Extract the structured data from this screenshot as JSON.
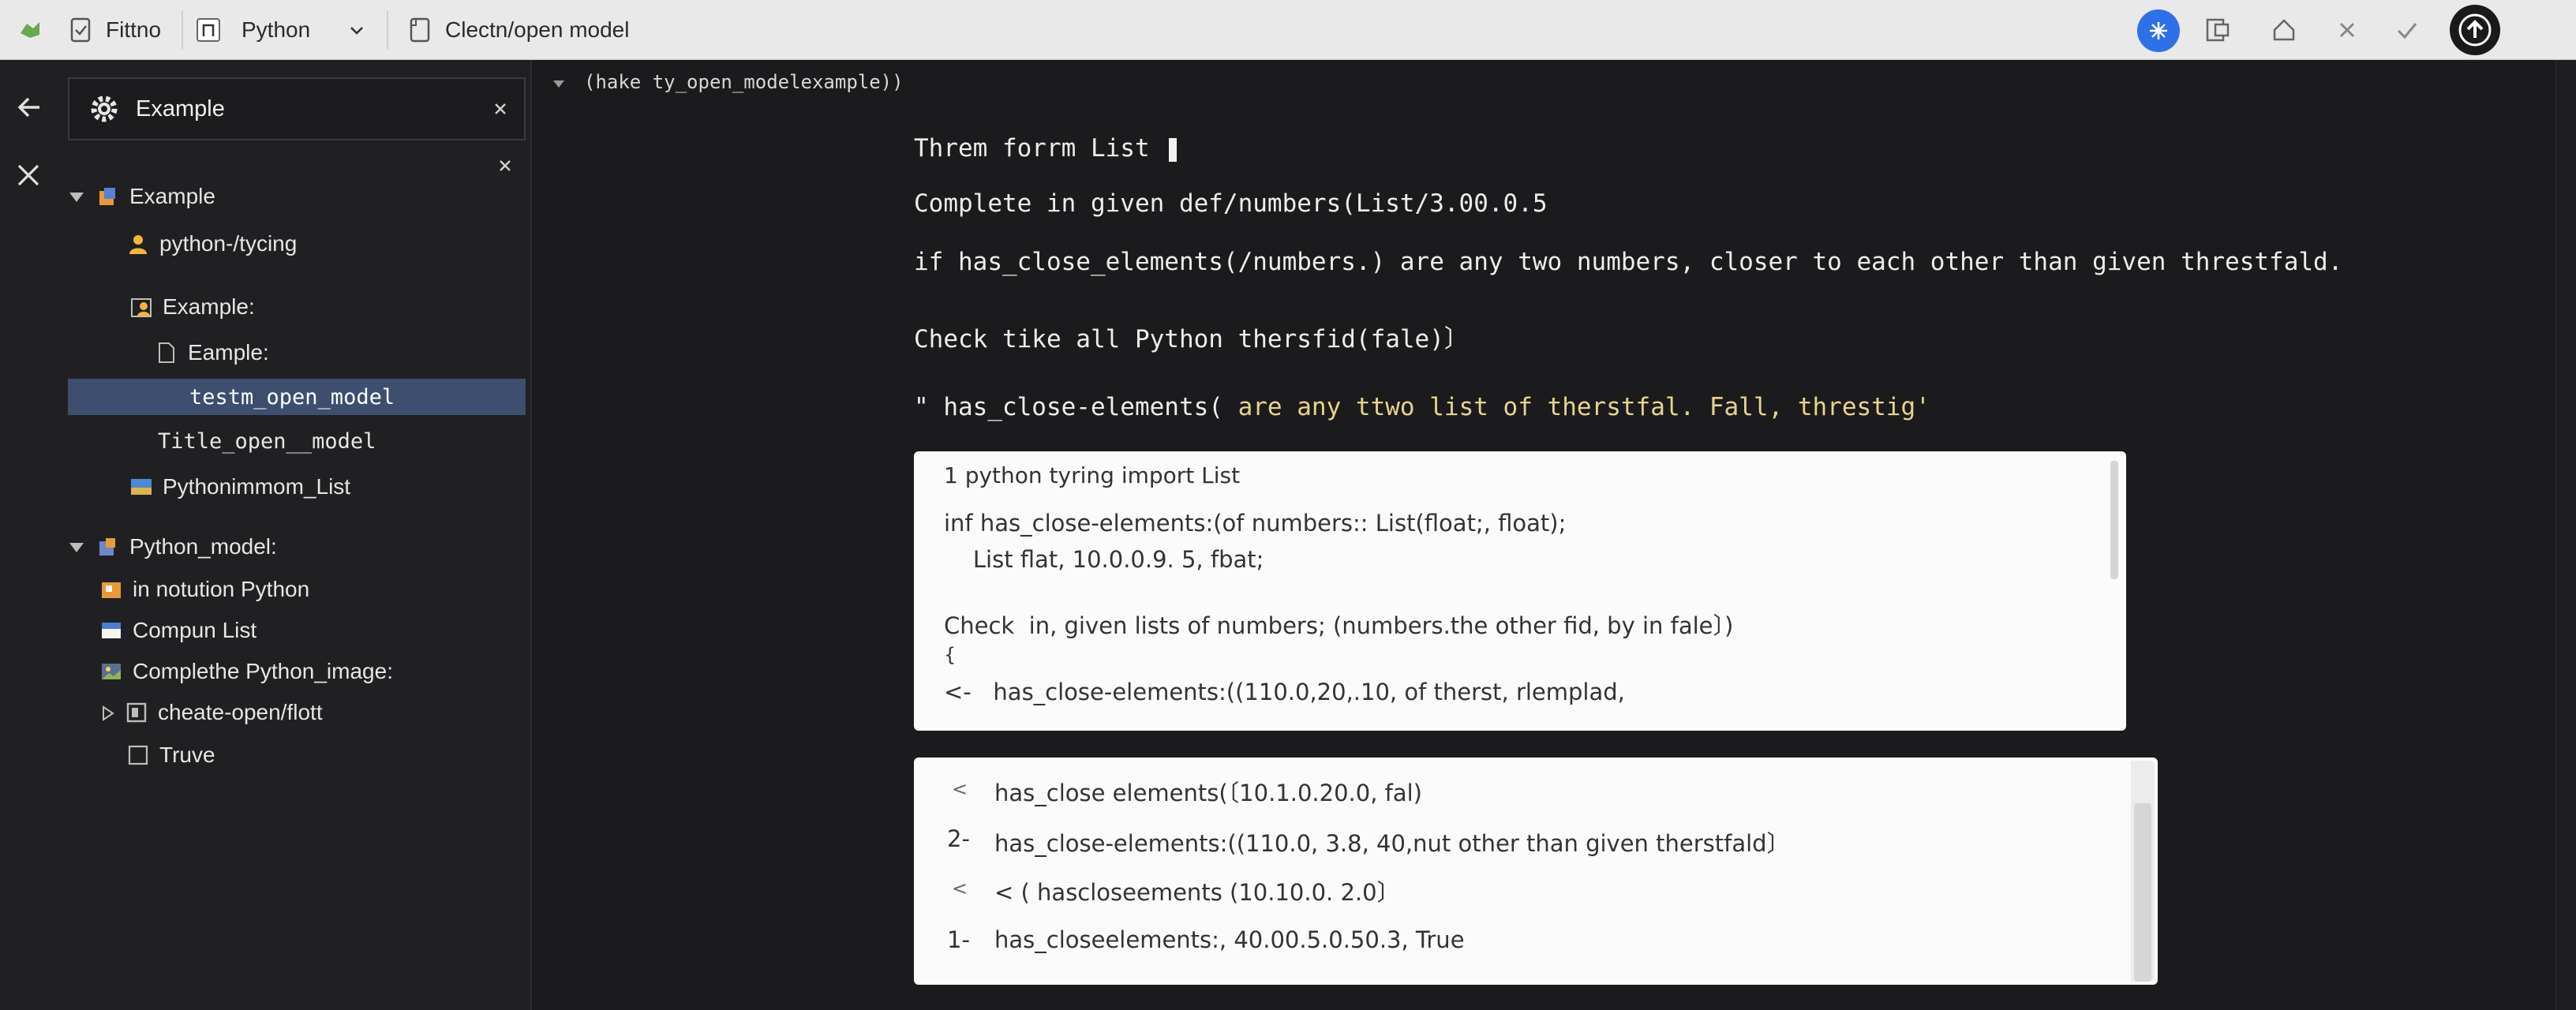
{
  "topbar": {
    "app_label": "Fittno",
    "language": "Python",
    "file_title": "Clectn/open model"
  },
  "sidebar": {
    "search_value": "Example",
    "tree": [
      {
        "label": "Example"
      },
      {
        "label": "python-/tycing"
      },
      {
        "label": "Example:"
      },
      {
        "label": "Eample:"
      },
      {
        "label": "testm_open_model"
      },
      {
        "label": "Title_open__model"
      },
      {
        "label": "Pythonimmom_List"
      },
      {
        "label": "Python_model:"
      },
      {
        "label": "in notution Python"
      },
      {
        "label": "Compun List"
      },
      {
        "label": "Complethe Python_image:"
      },
      {
        "label": "cheate-open/flott"
      },
      {
        "label": "Truve"
      }
    ]
  },
  "editor": {
    "breadcrumb": "(hake ty_open_modelexample))",
    "lines": [
      "Threm forrm List",
      "Complete in given def/numbers(List/3.00.0.5",
      "if has_close_elements(/numbers.) are any two numbers, closer to each other than given threstfald.",
      "Check tike all Python thersfid(fale)〕"
    ],
    "docstring_prefix": "\" has_close-elements(",
    "docstring_rest": "are any ttwo list of therstfal. Fall, threstig'",
    "panel1": [
      "1 python tyring import List",
      "inf has_close-elements:(of numbers:: List(float;, float);",
      "    List flat, 10.0.0.9. 5, fbat;",
      "Check  in, given lists of numbers; (numbers.the other fid, by in fale〕)",
      "{",
      "<-   has_close-elements:((110.0,20,.10, of therst, rlemplad,"
    ],
    "panel2": [
      {
        "num": "<",
        "text": "has_close elements(〔10.1.0.20.0, fal)"
      },
      {
        "num": "2-",
        "text": "has_close-elements:((110.0, 3.8, 40,nut other than given therstfald〕"
      },
      {
        "num": "<",
        "text": "< ( hascloseements (10.10.0. 2.0〕"
      },
      {
        "num": "1-",
        "text": "has_closeelements:, 40.00.5.0.50.3, True"
      }
    ]
  },
  "colors": {
    "accent_blue": "#2f6fe8",
    "selection": "#3d4e6e",
    "docstring_yellow": "#e8d48a"
  }
}
